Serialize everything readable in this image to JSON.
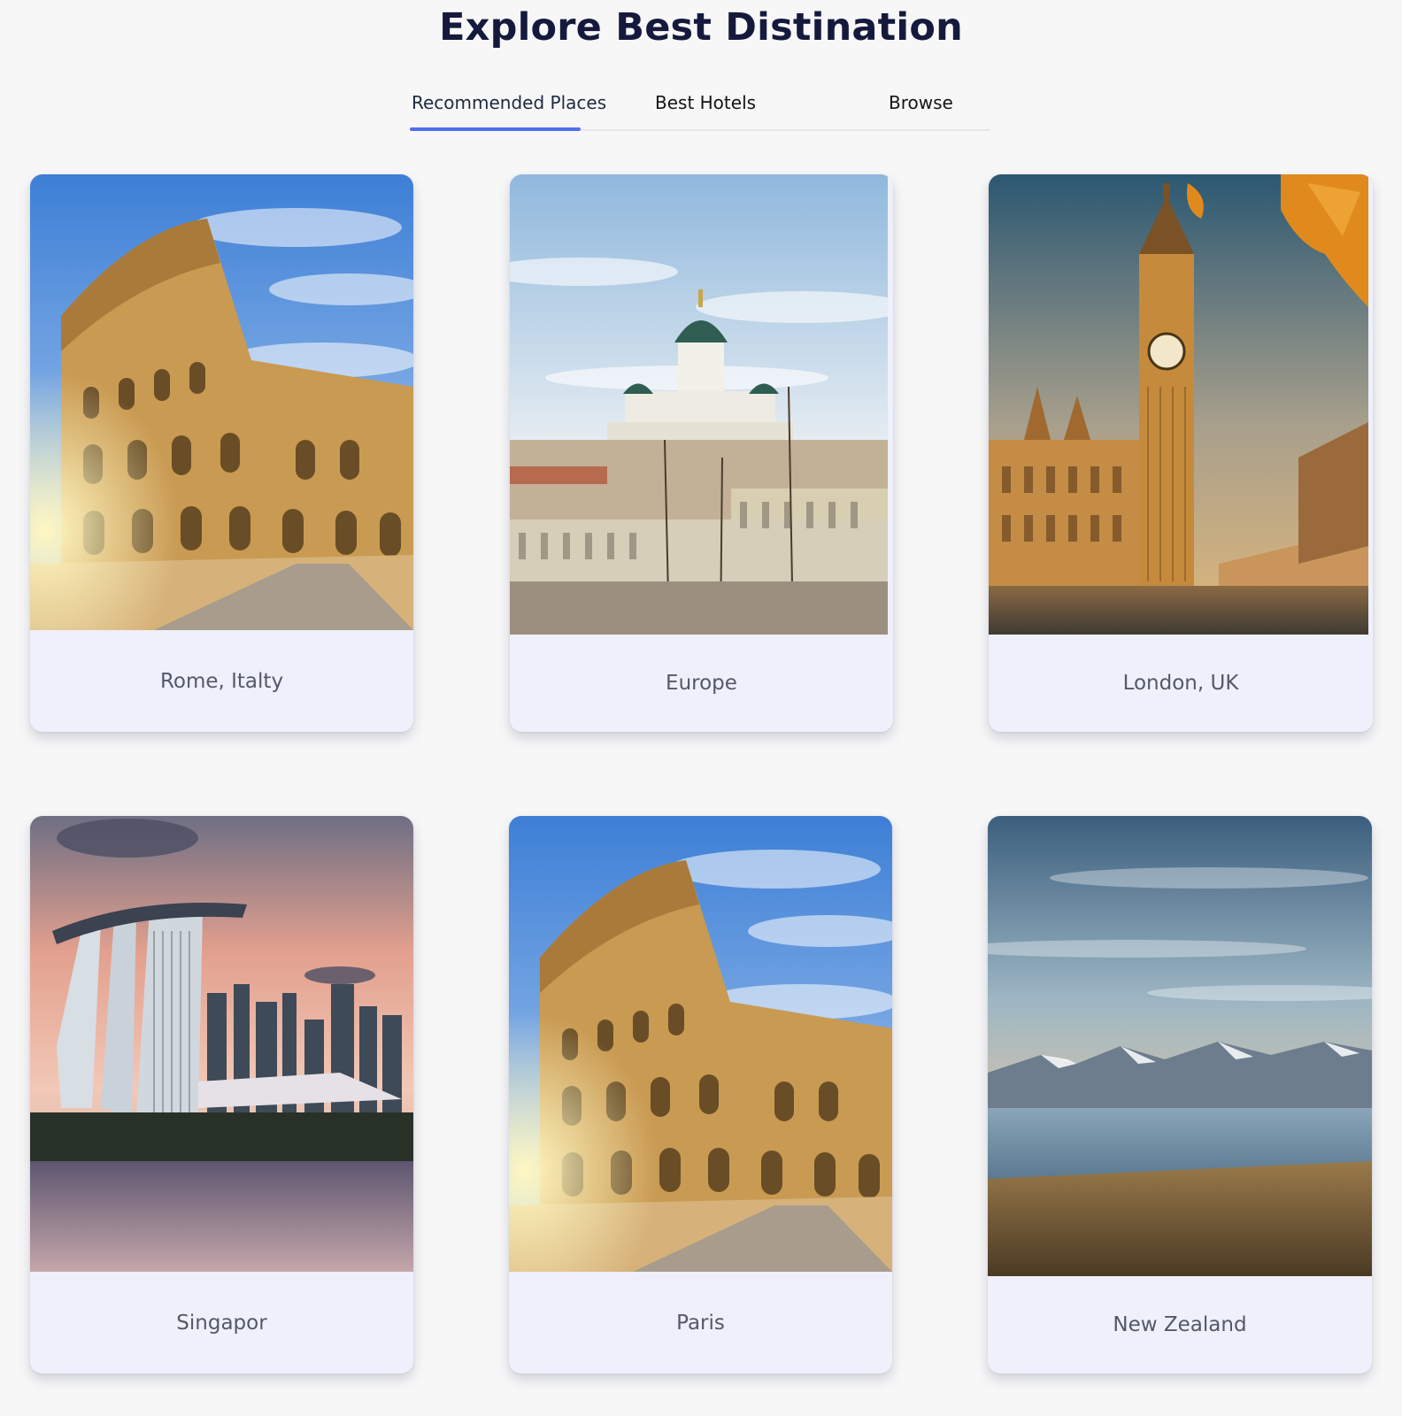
{
  "page": {
    "title": "Explore Best Distination"
  },
  "tabs": [
    {
      "label": "Recommended Places",
      "active": true
    },
    {
      "label": "Best Hotels",
      "active": false
    },
    {
      "label": "Browse",
      "active": false
    }
  ],
  "colors": {
    "accent": "#4f6ef0",
    "background": "#f7f7f8",
    "card_caption_bg": "#eef0fb",
    "title": "#151a3d"
  },
  "destinations": [
    {
      "caption": "Rome, Italty",
      "image": "colosseum"
    },
    {
      "caption": "Europe",
      "image": "helsinki-cathedral"
    },
    {
      "caption": "London, UK",
      "image": "big-ben"
    },
    {
      "caption": "Singapor",
      "image": "marina-bay"
    },
    {
      "caption": "Paris",
      "image": "colosseum"
    },
    {
      "caption": "New Zealand",
      "image": "mountain-lake"
    }
  ]
}
